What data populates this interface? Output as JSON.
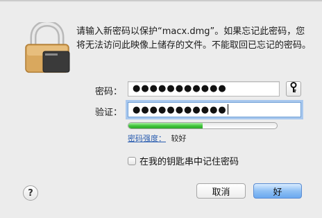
{
  "dialog": {
    "message": "请输入新密码以保护“macx.dmg”。如果忘记此密码，您将无法访问此映像上储存的文件。不能取回已忘记的密码。"
  },
  "password": {
    "label": "密码：",
    "value": "●●●●●●●●●●●"
  },
  "verify": {
    "label": "验证：",
    "value": "●●●●●●●●●●●"
  },
  "strength": {
    "link_label": "密码强度：",
    "level_text": "较好",
    "level_fraction": 0.5,
    "fill_color": "#3fc43a"
  },
  "keychain": {
    "checkbox_label": "在我的钥匙串中记住密码",
    "checked": false
  },
  "buttons": {
    "help": "?",
    "cancel": "取消",
    "ok": "好"
  },
  "icons": {
    "lock": "lock-icon",
    "key": "key-icon"
  }
}
